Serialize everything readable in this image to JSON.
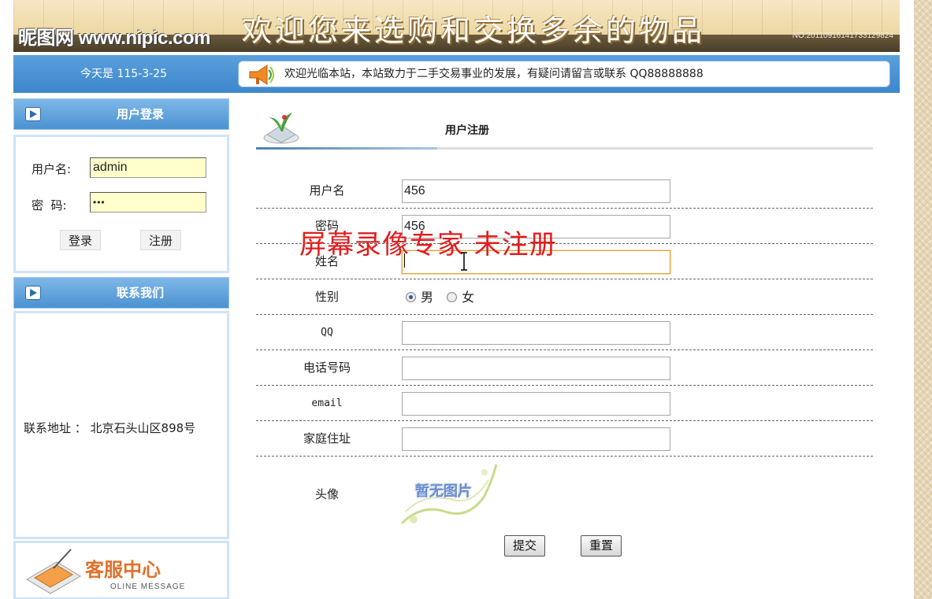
{
  "banner": {
    "logo": "昵图网 www.nipic.com",
    "headline": "欢迎您来选购和交换多余的物品",
    "serial": "NO:20110916141733129824"
  },
  "statusbar": {
    "date": "今天是 115-3-25",
    "notice": "欢迎光临本站，本站致力于二手交易事业的发展，有疑问请留言或联系 QQ88888888"
  },
  "login": {
    "title": "用户登录",
    "username_label": "用户名:",
    "username_value": "admin",
    "password_label": "密  码:",
    "password_value": "•••",
    "login_button": "登录",
    "register_button": "注册"
  },
  "contact": {
    "title": "联系我们",
    "address": "联系地址 ： 北京石头山区898号"
  },
  "service": {
    "title": "客服中心",
    "subtitle": "OLINE MESSAGE"
  },
  "form": {
    "title": "用户注册",
    "fields": [
      {
        "label": "用户名",
        "value": "456"
      },
      {
        "label": "密码",
        "value": "456"
      },
      {
        "label": "姓名",
        "value": ""
      },
      {
        "label": "性别",
        "value": ""
      },
      {
        "label": "QQ",
        "value": ""
      },
      {
        "label": "电话号码",
        "value": ""
      },
      {
        "label": "email",
        "value": ""
      },
      {
        "label": "家庭住址",
        "value": ""
      }
    ],
    "gender_options": [
      "男",
      "女"
    ],
    "gender_selected": "男",
    "avatar_label": "头像",
    "avatar_placeholder": "暂无图片",
    "submit_label": "提交",
    "reset_label": "重置"
  },
  "watermark": "屏幕录像专家  未注册",
  "colors": {
    "bar_blue": "#3d86cc",
    "input_yellow": "#ffffcc",
    "watermark_red": "#e01e1e",
    "focus_orange": "#e6a23c"
  }
}
